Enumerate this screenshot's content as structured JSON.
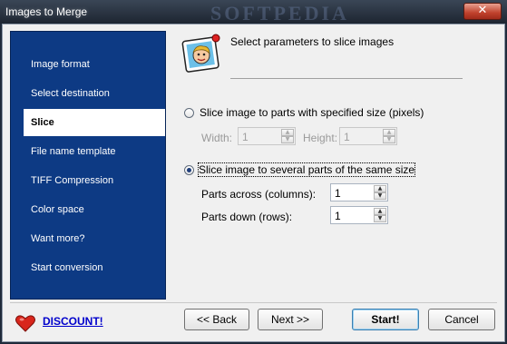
{
  "window": {
    "title": "Images to Merge",
    "watermark": "SOFTPEDIA",
    "close_glyph": "✕"
  },
  "sidebar": {
    "items": [
      {
        "label": "Image format"
      },
      {
        "label": "Select destination"
      },
      {
        "label": "Slice",
        "active": true
      },
      {
        "label": "File name template"
      },
      {
        "label": "TIFF Compression"
      },
      {
        "label": "Color space"
      },
      {
        "label": "Want more?"
      },
      {
        "label": "Start conversion"
      }
    ]
  },
  "header": {
    "title": "Select parameters to slice images",
    "icon": "cartoon-face-icon"
  },
  "options": {
    "by_size": {
      "label": "Slice image to parts with specified size (pixels)",
      "selected": false,
      "width_label": "Width:",
      "width_value": "1",
      "height_label": "Height:",
      "height_value": "1"
    },
    "by_count": {
      "label": "Slice image to several parts of the same size",
      "selected": true,
      "across_label": "Parts across (columns):",
      "across_value": "1",
      "down_label": "Parts down (rows):",
      "down_value": "1"
    }
  },
  "footer": {
    "discount_label": "DISCOUNT!",
    "back_label": "<< Back",
    "next_label": "Next >>",
    "start_label": "Start!",
    "cancel_label": "Cancel"
  },
  "spinner": {
    "up": "▲",
    "down": "▼"
  },
  "colors": {
    "sidebar_bg": "#0d3a84",
    "link": "#0000cc",
    "title_bar": "#1d2531"
  }
}
